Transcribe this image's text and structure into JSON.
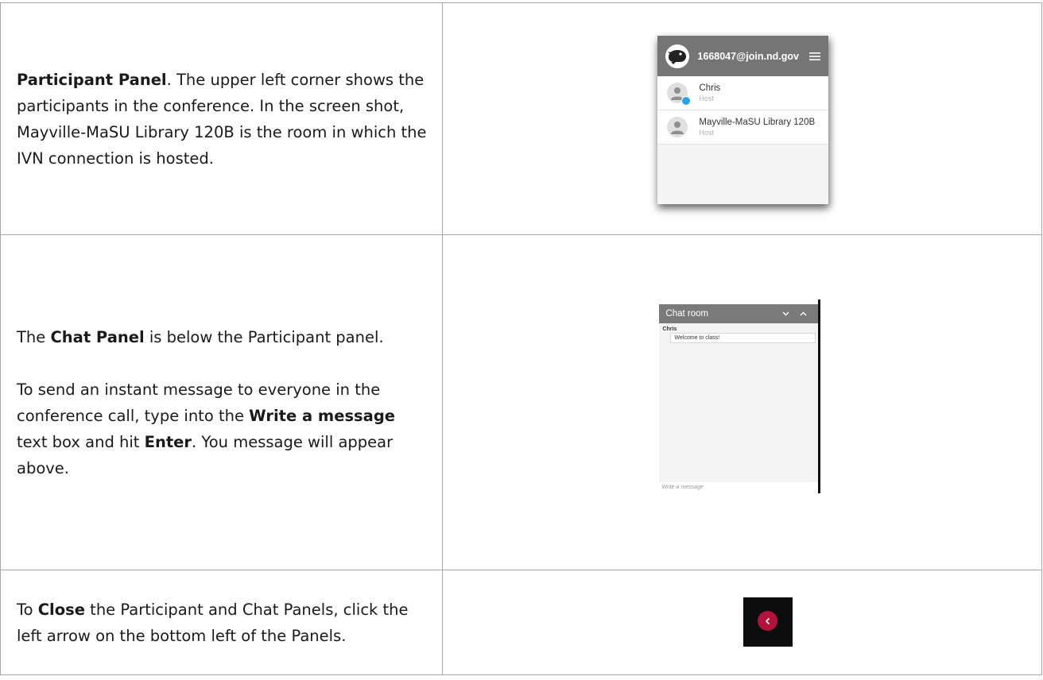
{
  "rows": [
    {
      "text": {
        "bold": "Participant Panel",
        "rest": ". The upper left corner shows the participants in the conference. In the screen shot, Mayville-MaSU Library 120B is the room in which the IVN connection is hosted."
      },
      "panel": {
        "title": "1668047@join.nd.gov",
        "icons": {
          "logo": "mascot-logo-icon",
          "menu": "hamburger-menu-icon",
          "avatar": "person-avatar-icon",
          "badge": "host-badge-icon"
        },
        "participants": [
          {
            "name": "Chris",
            "role": "Host"
          },
          {
            "name": "Mayville-MaSU Library 120B",
            "role": "Host"
          }
        ]
      }
    },
    {
      "text": {
        "p1_pre": "The ",
        "p1_bold": "Chat Panel",
        "p1_post": " is below the Participant panel.",
        "p2_pre": "To send an instant message to everyone in the conference call, type into the ",
        "p2_bold1": "Write a message",
        "p2_mid": " text box and hit ",
        "p2_bold2": "Enter",
        "p2_post": ". You message will appear above."
      },
      "chat": {
        "title": "Chat room",
        "icons": {
          "collapse": "chevron-down-icon",
          "expand": "chevron-up-icon"
        },
        "messages": [
          {
            "author": "Chris",
            "text": "Welcome to class!"
          }
        ],
        "input_placeholder": "Write a message"
      }
    },
    {
      "text": {
        "pre": "To ",
        "bold": "Close",
        "post": " the Participant and Chat Panels, click the left arrow on the bottom left of the Panels."
      },
      "close": {
        "icon": "chevron-left-icon",
        "color": "#b2123b"
      }
    }
  ]
}
